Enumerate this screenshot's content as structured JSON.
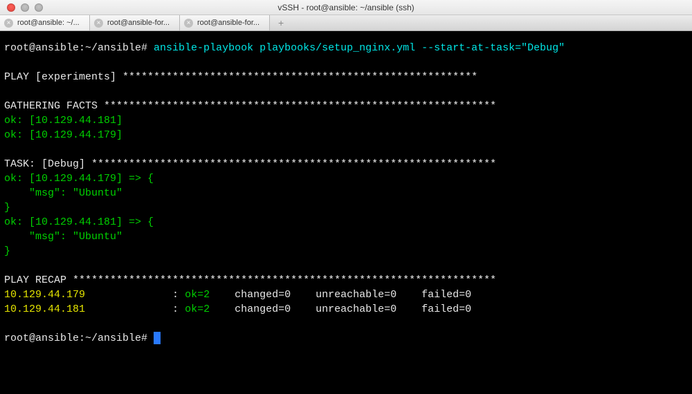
{
  "window": {
    "title": "vSSH - root@ansible: ~/ansible (ssh)"
  },
  "tabs": [
    {
      "label": "root@ansible: ~/...",
      "active": true
    },
    {
      "label": "root@ansible-for...",
      "active": false
    },
    {
      "label": "root@ansible-for...",
      "active": false
    }
  ],
  "terminal": {
    "prompt1": "root@ansible:~/ansible# ",
    "command": "ansible-playbook playbooks/setup_nginx.yml --start-at-task=\"Debug\"",
    "play_header_label": "PLAY [experiments] ",
    "play_header_stars": "*********************************************************",
    "gather_label": "GATHERING FACTS ",
    "gather_stars": "***************************************************************",
    "ok_host_181": "ok: [10.129.44.181]",
    "ok_host_179": "ok: [10.129.44.179]",
    "task_label": "TASK: [Debug] ",
    "task_stars": "*****************************************************************",
    "debug_179_open": "ok: [10.129.44.179] => {",
    "debug_msg_indent": "    \"msg\": \"Ubuntu\"",
    "debug_close": "}",
    "debug_181_open": "ok: [10.129.44.181] => {",
    "recap_label": "PLAY RECAP ",
    "recap_stars": "********************************************************************",
    "recap_row1_host": "10.129.44.179",
    "recap_row1_sep": "              : ",
    "recap_row1_ok": "ok=2   ",
    "recap_row1_rest": " changed=0    unreachable=0    failed=0   ",
    "recap_row2_host": "10.129.44.181",
    "recap_row2_sep": "              : ",
    "recap_row2_ok": "ok=2   ",
    "recap_row2_rest": " changed=0    unreachable=0    failed=0   ",
    "prompt2": "root@ansible:~/ansible# "
  }
}
